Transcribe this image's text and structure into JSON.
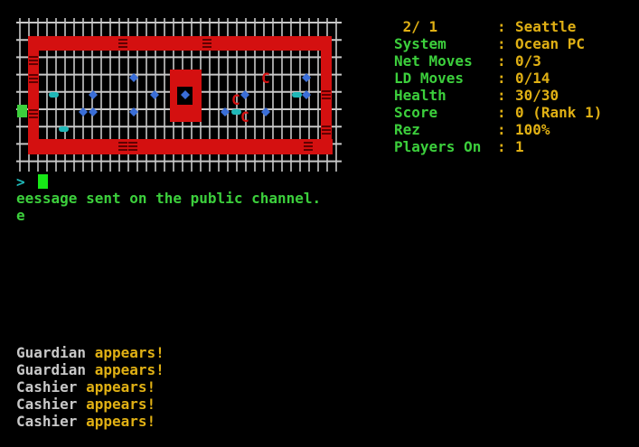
{
  "colors": {
    "grid": "#c8c8c8",
    "wall": "#d41010",
    "door": "#600000",
    "node": "#3a6ed8",
    "cyan": "#1fb8b8",
    "enemy": "#d41010",
    "player": "#3ccf3c",
    "label": "#3ccf3c",
    "value": "#e0b014",
    "message": "#3ccf3c"
  },
  "stats": [
    {
      "label": " 2/ 1",
      "value": "Seattle"
    },
    {
      "label": "System",
      "value": "Ocean PC"
    },
    {
      "label": "Net Moves",
      "value": "0/3"
    },
    {
      "label": "LD Moves",
      "value": "0/14"
    },
    {
      "label": "Health",
      "value": "30/30"
    },
    {
      "label": "Score",
      "value": "0 (Rank 1)"
    },
    {
      "label": "Rez",
      "value": "100%"
    },
    {
      "label": "Players On",
      "value": "1"
    }
  ],
  "stat_separator": ":",
  "stat_separator_last": ":",
  "prompt": ">",
  "message_line1": "eessage sent on the public channel.",
  "message_line2": "e",
  "map_symbols": {
    "enemy": "C"
  },
  "log": [
    {
      "who": "Guardian",
      "what": "appears!"
    },
    {
      "who": "Guardian",
      "what": "appears!"
    },
    {
      "who": "Cashier",
      "what": "appears!"
    },
    {
      "who": "Cashier",
      "what": "appears!"
    },
    {
      "who": "Cashier",
      "what": "appears!"
    }
  ]
}
